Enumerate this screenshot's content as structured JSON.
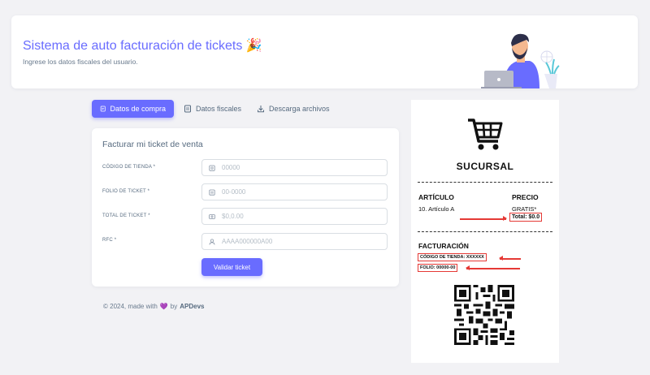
{
  "header": {
    "title": "Sistema de auto facturación de tickets 🎉",
    "subtitle": "Ingrese los datos fiscales del usuario."
  },
  "tabs": [
    {
      "label": "Datos de compra",
      "icon": "receipt-icon",
      "active": true
    },
    {
      "label": "Datos fiscales",
      "icon": "document-icon",
      "active": false
    },
    {
      "label": "Descarga archivos",
      "icon": "download-icon",
      "active": false
    }
  ],
  "form": {
    "title": "Facturar mi ticket de venta",
    "fields": [
      {
        "label": "CÓDIGO DE TIENDA *",
        "placeholder": "00000",
        "icon": "store-icon"
      },
      {
        "label": "FOLIO DE TICKET *",
        "placeholder": "00-0000",
        "icon": "document-icon"
      },
      {
        "label": "TOTAL DE TICKET *",
        "placeholder": "$0,0.00",
        "icon": "money-icon"
      },
      {
        "label": "RFC *",
        "placeholder": "AAAA000000A00",
        "icon": "user-icon"
      }
    ],
    "submit_label": "Validar ticket"
  },
  "footer": {
    "text": "© 2024, made with",
    "heart": "💜",
    "by": "by",
    "brand": "APDevs"
  },
  "ticket": {
    "sucursal": "SUCURSAL",
    "col_article": "ARTÍCULO",
    "col_price": "PRECIO",
    "item": "10. Artículo A",
    "item_price": "GRATIS*",
    "total": "Total: $0.0",
    "facturacion": "FACTURACIÓN",
    "codigo": "CÓDIGO DE TIENDA: XXXXXX",
    "folio": "FOLIO: 00000-00"
  },
  "colors": {
    "accent": "#696cff",
    "annotation": "#e53935"
  }
}
